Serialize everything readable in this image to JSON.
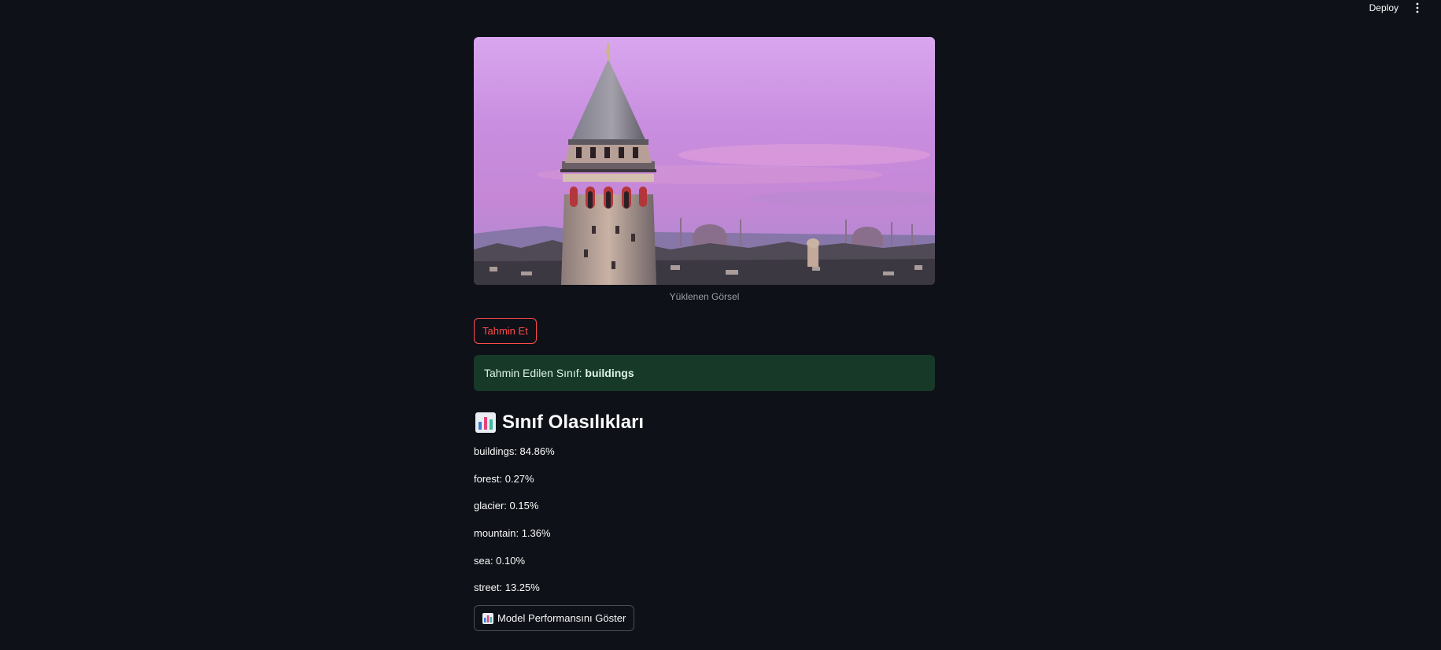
{
  "topbar": {
    "deploy_label": "Deploy",
    "menu_icon": "kebab-menu-icon"
  },
  "image": {
    "caption": "Yüklenen Görsel"
  },
  "predict_button": {
    "label": "Tahmin Et"
  },
  "result": {
    "prefix": "Tahmin Edilen Sınıf: ",
    "predicted_class": "buildings"
  },
  "probabilities_section": {
    "icon": "bar-chart-icon",
    "title": "Sınıf Olasılıkları",
    "items": [
      "buildings: 84.86%",
      "forest: 0.27%",
      "glacier: 0.15%",
      "mountain: 1.36%",
      "sea: 0.10%",
      "street: 13.25%"
    ]
  },
  "performance_button": {
    "icon": "bar-chart-icon",
    "label": "Model Performansını Göster"
  },
  "colors": {
    "background": "#0e1117",
    "accent": "#ff4b4b",
    "success_bg": "#173928"
  }
}
